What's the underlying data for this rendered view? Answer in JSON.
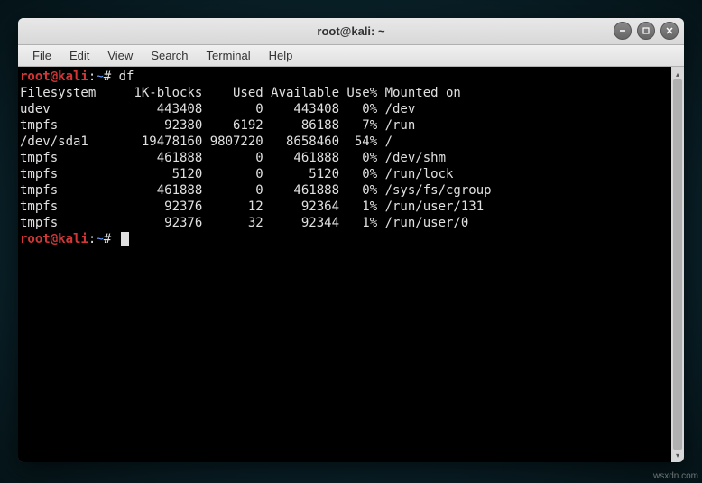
{
  "window": {
    "title": "root@kali: ~"
  },
  "menu": {
    "file": "File",
    "edit": "Edit",
    "view": "View",
    "search": "Search",
    "terminal": "Terminal",
    "help": "Help"
  },
  "prompt": {
    "user": "root",
    "at": "@",
    "host": "kali",
    "sep": ":",
    "path": "~",
    "hash": "#"
  },
  "command": "df",
  "df_header": {
    "filesystem": "Filesystem",
    "blocks": "1K-blocks",
    "used": "Used",
    "available": "Available",
    "usepct": "Use%",
    "mounted": "Mounted on"
  },
  "df_rows": [
    {
      "fs": "udev",
      "blocks": "443408",
      "used": "0",
      "avail": "443408",
      "usepct": "0%",
      "mount": "/dev"
    },
    {
      "fs": "tmpfs",
      "blocks": "92380",
      "used": "6192",
      "avail": "86188",
      "usepct": "7%",
      "mount": "/run"
    },
    {
      "fs": "/dev/sda1",
      "blocks": "19478160",
      "used": "9807220",
      "avail": "8658460",
      "usepct": "54%",
      "mount": "/"
    },
    {
      "fs": "tmpfs",
      "blocks": "461888",
      "used": "0",
      "avail": "461888",
      "usepct": "0%",
      "mount": "/dev/shm"
    },
    {
      "fs": "tmpfs",
      "blocks": "5120",
      "used": "0",
      "avail": "5120",
      "usepct": "0%",
      "mount": "/run/lock"
    },
    {
      "fs": "tmpfs",
      "blocks": "461888",
      "used": "0",
      "avail": "461888",
      "usepct": "0%",
      "mount": "/sys/fs/cgroup"
    },
    {
      "fs": "tmpfs",
      "blocks": "92376",
      "used": "12",
      "avail": "92364",
      "usepct": "1%",
      "mount": "/run/user/131"
    },
    {
      "fs": "tmpfs",
      "blocks": "92376",
      "used": "32",
      "avail": "92344",
      "usepct": "1%",
      "mount": "/run/user/0"
    }
  ],
  "watermark": "wsxdn.com"
}
